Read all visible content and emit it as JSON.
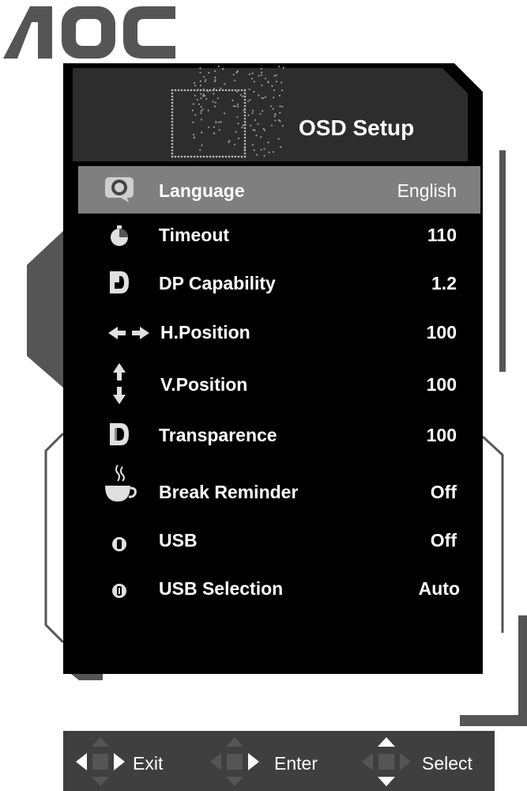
{
  "brand": {
    "logo_text": "AOC"
  },
  "osd": {
    "title": "OSD Setup",
    "items": [
      {
        "label": "Language",
        "value": "English",
        "icon": "language-icon",
        "selected": true
      },
      {
        "label": "Timeout",
        "value": "110",
        "icon": "timer-icon",
        "selected": false
      },
      {
        "label": "DP Capability",
        "value": "1.2",
        "icon": "displayport-icon",
        "selected": false
      },
      {
        "label": "H.Position",
        "value": "100",
        "icon": "horizontal-arrows-icon",
        "selected": false
      },
      {
        "label": "V.Position",
        "value": "100",
        "icon": "vertical-arrows-icon",
        "selected": false
      },
      {
        "label": "Transparence",
        "value": "100",
        "icon": "transparency-icon",
        "selected": false
      },
      {
        "label": "Break Reminder",
        "value": "Off",
        "icon": "coffee-cup-icon",
        "selected": false
      },
      {
        "label": "USB",
        "value": "Off",
        "icon": "usb-icon",
        "selected": false
      },
      {
        "label": "USB Selection",
        "value": "Auto",
        "icon": "usb-selection-icon",
        "selected": false
      }
    ]
  },
  "navbar": {
    "exit": "Exit",
    "enter": "Enter",
    "select": "Select"
  },
  "colors": {
    "panel": "#000000",
    "header": "#2d2d2d",
    "selected_row": "#7f7f7f",
    "frame": "#555555",
    "bottom_bar": "#3f3f3f",
    "text": "#ffffff"
  }
}
